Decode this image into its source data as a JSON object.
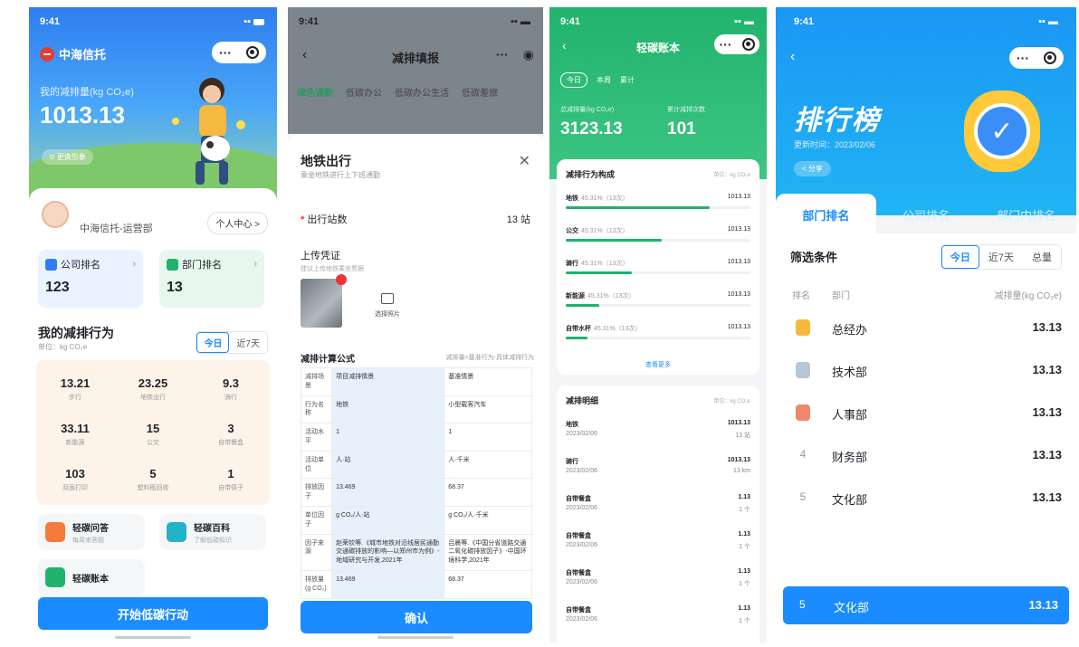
{
  "time": "9:41",
  "p1": {
    "brand": "中海信托",
    "my_label": "我的减排量(kg CO₂e)",
    "my_value": "1013.13",
    "pill": "⊙ 更换形象",
    "user": "中海信托-运营部",
    "user_center": "个人中心 >",
    "company_rank_label": "公司排名",
    "company_rank": "123",
    "dept_rank_label": "部门排名",
    "dept_rank": "13",
    "section": "我的减排行为",
    "unit": "单位：kg CO₂e",
    "seg": [
      "今日",
      "近7天"
    ],
    "stats": [
      {
        "n": "13.21",
        "l": "步行"
      },
      {
        "n": "23.25",
        "l": "地铁出行"
      },
      {
        "n": "9.3",
        "l": "骑行"
      },
      {
        "n": "33.11",
        "l": "新能源"
      },
      {
        "n": "15",
        "l": "公交"
      },
      {
        "n": "3",
        "l": "自带餐盒"
      },
      {
        "n": "103",
        "l": "双面打印"
      },
      {
        "n": "5",
        "l": "塑料瓶回收"
      },
      {
        "n": "1",
        "l": "自带筷子"
      }
    ],
    "feat": [
      {
        "t": "轻碳问答",
        "s": "每周来答题"
      },
      {
        "t": "轻碳百科",
        "s": "了解低碳知识"
      },
      {
        "t": "轻碳账本",
        "s": ""
      }
    ],
    "cta": "开始低碳行动"
  },
  "p2": {
    "title": "减排填报",
    "tabs": [
      "绿色通勤",
      "低碳办公",
      "低碳办公生活",
      "低碳差旅"
    ],
    "modal_title": "地铁出行",
    "modal_sub": "乘坐地铁进行上下班通勤",
    "field": "出行站数",
    "field_value": "13 站",
    "upload": "上传凭证",
    "upload_hint": "建议上传地铁乘坐票据",
    "pick": "选择照片",
    "formula_title": "减排计算公式",
    "formula_expr": "减排量=基准行为-具体减排行为",
    "table": [
      [
        "减排场景",
        "项目减排情景",
        "基准情景"
      ],
      [
        "行为名称",
        "地铁",
        "小型载客汽车"
      ],
      [
        "活动水平",
        "1",
        "1"
      ],
      [
        "活动单位",
        "人·站",
        "人·千米"
      ],
      [
        "排放因子",
        "13.469",
        "68.37"
      ],
      [
        "单位因子",
        "g CO₂/人·站",
        "g CO₂/人·千米"
      ],
      [
        "因子来源",
        "赵荣钦等.《城市地铁对沿线居民通勤交通碳排放的影响—以郑州市为例》-地域研究与开发,2021年",
        "吕晨等.《中国分省道路交通二氧化碳排放因子》-中国环境科学,2021年"
      ],
      [
        "排放量(g CO₂)",
        "13.469",
        "68.37"
      ]
    ],
    "confirm": "确认"
  },
  "p3": {
    "title": "轻碳账本",
    "tabs": [
      "今日",
      "本周",
      "累计"
    ],
    "total_label": "总减排量(kg CO₂e)",
    "count_label": "累计减排次数",
    "total": "3123.13",
    "count": "101",
    "comp_title": "减排行为构成",
    "unit": "单位：kg CO₂e",
    "comp": [
      {
        "name": "地铁",
        "pct": "45.31%（13次）",
        "value": "1013.13",
        "ratio": 0.78
      },
      {
        "name": "公交",
        "pct": "45.31%（13次）",
        "value": "1013.13",
        "ratio": 0.52
      },
      {
        "name": "骑行",
        "pct": "45.31%（13次）",
        "value": "1013.13",
        "ratio": 0.36
      },
      {
        "name": "新能源",
        "pct": "45.31%（13次）",
        "value": "1013.13",
        "ratio": 0.18
      },
      {
        "name": "自带水杯",
        "pct": "45.31%（13次）",
        "value": "1013.13",
        "ratio": 0.12
      }
    ],
    "more": "查看更多",
    "detail_title": "减排明细",
    "detail": [
      {
        "name": "地铁",
        "date": "2023/02/06",
        "value": "1013.13",
        "sub": "13 站"
      },
      {
        "name": "骑行",
        "date": "2023/02/06",
        "value": "1013.13",
        "sub": "13 km"
      },
      {
        "name": "自带餐盒",
        "date": "2023/02/06",
        "value": "1.13",
        "sub": "1 个"
      },
      {
        "name": "自带餐盒",
        "date": "2023/02/06",
        "value": "1.13",
        "sub": "1 个"
      },
      {
        "name": "自带餐盒",
        "date": "2023/02/06",
        "value": "1.13",
        "sub": "1 个"
      },
      {
        "name": "自带餐盒",
        "date": "2023/02/06",
        "value": "1.13",
        "sub": "1 个"
      }
    ]
  },
  "p4": {
    "title": "排行榜",
    "updated": "更新时间：2023/02/06",
    "share": "< 分享",
    "tabs": [
      "部门排名",
      "公司排名",
      "部门内排名"
    ],
    "filter": "筛选条件",
    "seg": [
      "今日",
      "近7天",
      "总量"
    ],
    "th": [
      "排名",
      "部门",
      "减排量(kg CO₂e)"
    ],
    "rows": [
      {
        "rank": "1",
        "dept": "总经办",
        "value": "13.13",
        "color": "#f6b93b"
      },
      {
        "rank": "2",
        "dept": "技术部",
        "value": "13.13",
        "color": "#b8c6d6"
      },
      {
        "rank": "3",
        "dept": "人事部",
        "value": "13.13",
        "color": "#f0866b"
      },
      {
        "rank": "4",
        "dept": "财务部",
        "value": "13.13"
      },
      {
        "rank": "5",
        "dept": "文化部",
        "value": "13.13"
      }
    ],
    "mine": {
      "rank": "5",
      "dept": "文化部",
      "value": "13.13"
    }
  }
}
